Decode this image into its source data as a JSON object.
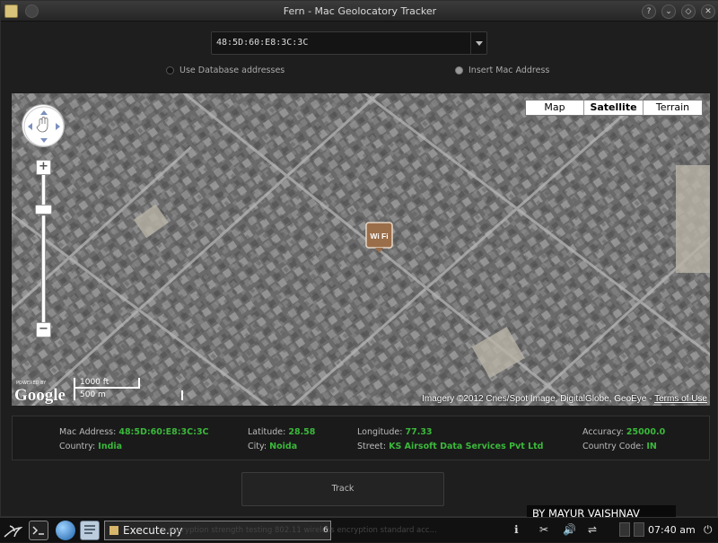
{
  "window": {
    "title": "Fern - Mac Geolocatory Tracker",
    "controls": [
      "?",
      "⌄",
      "◇",
      "✕"
    ]
  },
  "form": {
    "mac_combo_value": "48:5D:60:E8:3C:3C",
    "radio_database": "Use Database addresses",
    "radio_insert": "Insert Mac Address",
    "selected_radio": "Insert Mac Address"
  },
  "map": {
    "types": [
      "Map",
      "Satellite",
      "Terrain"
    ],
    "active_type": "Satellite",
    "powered_by": "POWERED BY",
    "logo": "Google",
    "scale_ft": "1000 ft",
    "scale_m": "500 m",
    "attribution": "Imagery ©2012 Cnes/Spot Image, DigitalGlobe, GeoEye -",
    "terms": "Terms of Use",
    "marker_icon": "wifi-marker-icon",
    "marker_text": "Wi Fi"
  },
  "info": {
    "mac_label": "Mac Address:",
    "mac_value": "48:5D:60:E8:3C:3C",
    "lat_label": "Latitude:",
    "lat_value": "28.58",
    "lon_label": "Longitude:",
    "lon_value": "77.33",
    "acc_label": "Accuracy:",
    "acc_value": "25000.0",
    "country_label": "Country:",
    "country_value": "India",
    "city_label": "City:",
    "city_value": "Noida",
    "street_label": "Street:",
    "street_value": "KS Airsoft Data Services Pvt Ltd",
    "code_label": "Country Code:",
    "code_value": "IN"
  },
  "track_button": "Track",
  "taskbar": {
    "task_label": "Execute.py",
    "ticker": "s  encryption strength testing  802.11 wireless encryption standard  acc...",
    "credit": "BY MAYUR VAISHNAV",
    "clock": "07:40 am",
    "badge": "6"
  },
  "colors": {
    "value_green": "#3bb83b",
    "background": "#1e1e1e"
  }
}
